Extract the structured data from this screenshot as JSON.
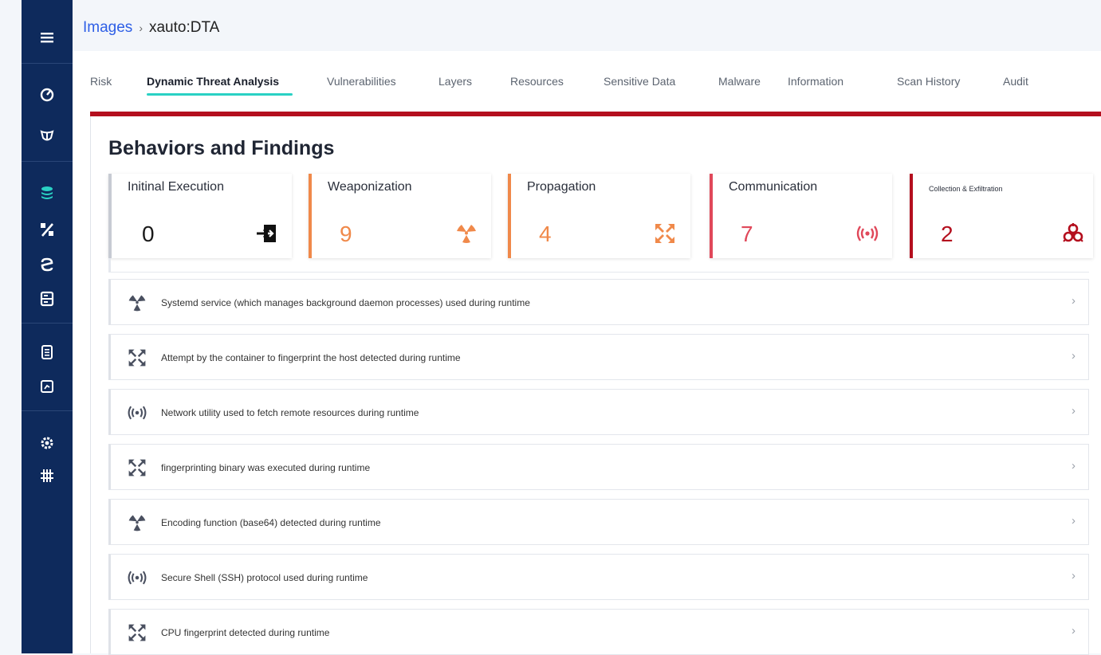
{
  "breadcrumb": {
    "parent": "Images",
    "separator": "›",
    "current": "xauto:DTA"
  },
  "tabs": [
    {
      "label": "Risk"
    },
    {
      "label": "Dynamic Threat Analysis"
    },
    {
      "label": "Vulnerabilities"
    },
    {
      "label": "Layers"
    },
    {
      "label": "Resources"
    },
    {
      "label": "Sensitive Data"
    },
    {
      "label": "Malware"
    },
    {
      "label": "Information"
    },
    {
      "label": "Scan History"
    },
    {
      "label": "Audit"
    }
  ],
  "active_tab": "Dynamic Threat Analysis",
  "section_title": "Behaviors and Findings",
  "cards": [
    {
      "title": "Initinal Execution",
      "value": "0",
      "icon": "execution-icon",
      "color": "#c7cbd3",
      "value_color": "#1a1a1a"
    },
    {
      "title": "Weaponization",
      "value": "9",
      "icon": "radiation-icon",
      "color": "#f0894a",
      "value_color": "#f0894a"
    },
    {
      "title": "Propagation",
      "value": "4",
      "icon": "propagation-icon",
      "color": "#f0894a",
      "value_color": "#f0894a"
    },
    {
      "title": "Communication",
      "value": "7",
      "icon": "broadcast-icon",
      "color": "#e0485a",
      "value_color": "#e0485a"
    },
    {
      "title": "Collection & Exfiltration",
      "value": "2",
      "icon": "biohazard-icon",
      "color": "#b40f1e",
      "value_color": "#b40f1e"
    }
  ],
  "findings": [
    {
      "text": "Systemd service (which manages background daemon processes) used during runtime",
      "icon": "radiation-icon"
    },
    {
      "text": "Attempt by the container to fingerprint the host detected during runtime",
      "icon": "propagation-icon"
    },
    {
      "text": "Network utility used to fetch remote resources during runtime",
      "icon": "broadcast-icon"
    },
    {
      "text": "fingerprinting binary was executed during runtime",
      "icon": "propagation-icon"
    },
    {
      "text": "Encoding function (base64) detected during runtime",
      "icon": "radiation-icon"
    },
    {
      "text": "Secure Shell (SSH) protocol used during runtime",
      "icon": "broadcast-icon"
    },
    {
      "text": "CPU fingerprint detected during runtime",
      "icon": "propagation-icon"
    }
  ],
  "chevron": "›",
  "colors": {
    "sidebar_bg": "#0e2a5c",
    "accent_teal": "#2ad1c4",
    "alert_red": "#b40f1e",
    "link_blue": "#2e5fe6"
  },
  "sidebar_icons": [
    "menu-icon",
    "dashboard-icon",
    "shield-icon",
    "images-stack-icon",
    "percent-icon",
    "registry-icon",
    "server-icon",
    "document-icon",
    "report-icon",
    "settings-icon",
    "grid-icon"
  ]
}
